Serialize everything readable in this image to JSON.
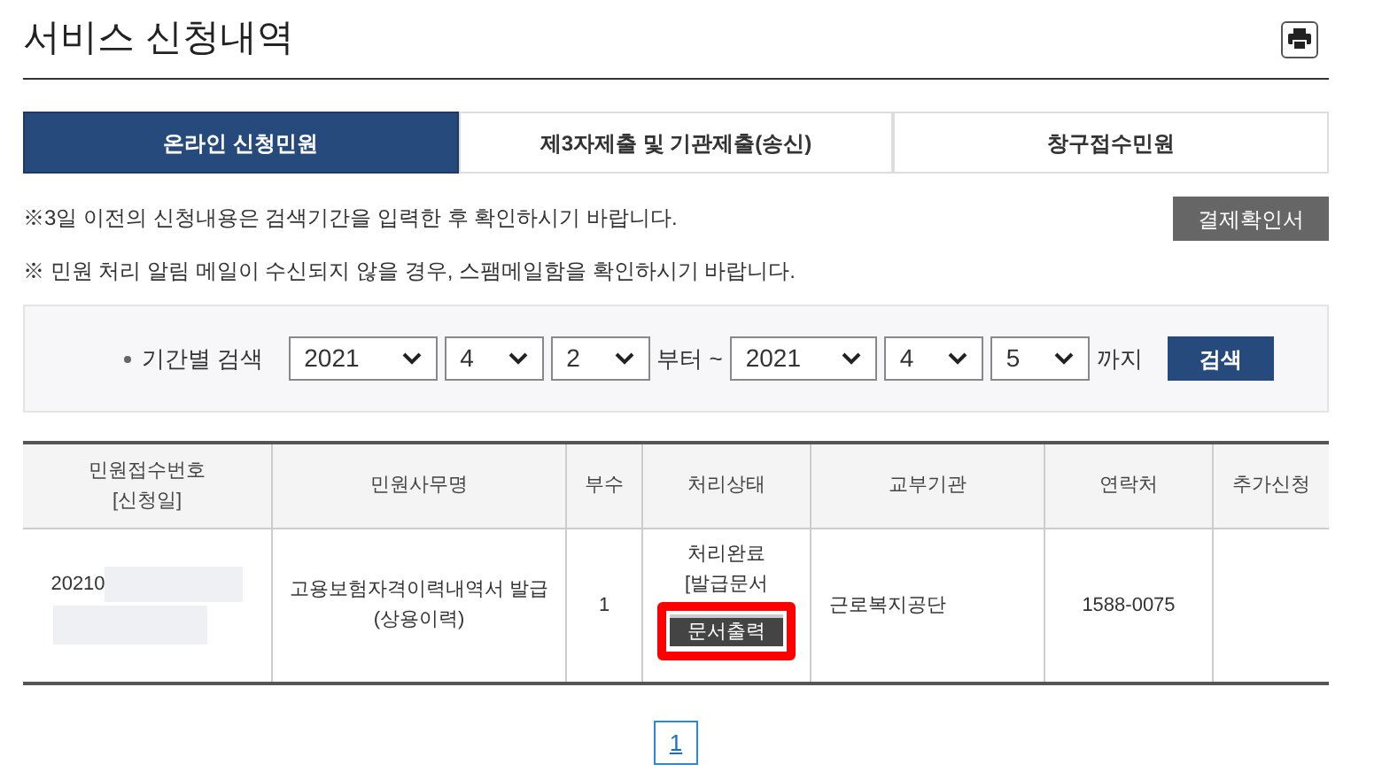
{
  "title": "서비스 신청내역",
  "tabs": [
    {
      "label": "온라인 신청민원",
      "selected": true
    },
    {
      "label": "제3자제출 및 기관제출(송신)",
      "selected": false
    },
    {
      "label": "창구접수민원",
      "selected": false
    }
  ],
  "notes": [
    "※3일 이전의 신청내용은 검색기간을 입력한 후 확인하시기 바랍니다.",
    "※ 민원 처리 알림 메일이 수신되지 않을 경우, 스팸메일함을 확인하시기 바랍니다."
  ],
  "receipt_button": "결제확인서",
  "search": {
    "label": "기간별 검색",
    "from": [
      "2021",
      "4",
      "2"
    ],
    "from_suffix": "부터 ~",
    "to": [
      "2021",
      "4",
      "5"
    ],
    "to_suffix": "까지",
    "button": "검색"
  },
  "table": {
    "columns": [
      "민원접수번호\n[신청일]",
      "민원사무명",
      "부수",
      "처리상태",
      "교부기관",
      "연락처",
      "추가신청"
    ],
    "rows": [
      {
        "number": "20210",
        "name": "고용보험자격이력내역서 발급(상용이력)",
        "copies": "1",
        "status": "처리완료\n[발급문서",
        "print_button": "문서출력",
        "highlighted": true,
        "agency": "근로복지공단",
        "phone": "1588-0075"
      }
    ]
  },
  "pages": [
    {
      "label": "1",
      "selected": true
    }
  ]
}
